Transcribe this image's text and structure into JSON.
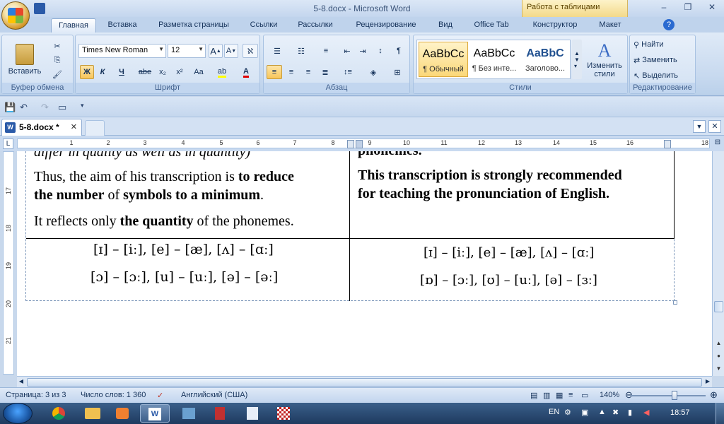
{
  "window": {
    "title": "5-8.docx - Microsoft Word",
    "context_tab": "Работа с таблицами"
  },
  "ribbon_tabs": [
    "Главная",
    "Вставка",
    "Разметка страницы",
    "Ссылки",
    "Рассылки",
    "Рецензирование",
    "Вид",
    "Office Tab",
    "Конструктор",
    "Макет"
  ],
  "clipboard": {
    "paste_label": "Вставить",
    "group_label": "Буфер обмена"
  },
  "font": {
    "name": "Times New Roman",
    "size": "12",
    "group_label": "Шрифт",
    "bold_label": "Ж",
    "italic_label": "К",
    "underline_label": "Ч",
    "strike_label": "abe",
    "sub_label": "x₂",
    "sup_label": "x²",
    "case_label": "Aa"
  },
  "paragraph": {
    "group_label": "Абзац"
  },
  "styles": {
    "group_label": "Стили",
    "items": [
      {
        "sample": "AaBbCc",
        "name": "¶ Обычный"
      },
      {
        "sample": "AaBbCc",
        "name": "¶ Без инте..."
      },
      {
        "sample": "AaBbC",
        "name": "Заголово..."
      }
    ],
    "change_label": "Изменить стили"
  },
  "editing": {
    "group_label": "Редактирование",
    "find": "Найти",
    "replace": "Заменить",
    "select": "Выделить"
  },
  "doc_tab": {
    "label": "5-8.docx *"
  },
  "ruler": {
    "numbers": [
      "1",
      "2",
      "3",
      "4",
      "5",
      "6",
      "7",
      "8",
      "9",
      "10",
      "11",
      "12",
      "13",
      "14",
      "15",
      "16",
      "18"
    ]
  },
  "vruler": {
    "numbers": [
      "17",
      "18",
      "19",
      "20",
      "21"
    ]
  },
  "document": {
    "left_top_cut": "differ in quality as well as in quantity)",
    "left_p1a_pre": "Thus, the aim of his transcription is ",
    "left_p1a_bold": "to reduce",
    "left_p1b_bold": "the number",
    "left_p1b_mid": " of ",
    "left_p1b_bold2": "symbols to a minimum",
    "left_p1b_end": ".",
    "left_p2_pre": "It reflects only ",
    "left_p2_bold": "the quantity",
    "left_p2_end": " of the phonemes.",
    "right_top_cut": "phonemes.",
    "right_p1": "This transcription  is strongly  recommended",
    "right_p2": "for teaching  the pronunciation  of English.",
    "left_sym1": "[ɪ] – [iː], [e] – [æ], [ʌ] – [ɑː]",
    "left_sym2": "[ɔ] – [ɔː], [u] – [uː], [ə] – [əː]",
    "right_sym1": "[ɪ] – [iː], [e] – [æ], [ʌ] – [ɑː]",
    "right_sym2": "[ɒ] – [ɔː], [ʊ] – [uː], [ə] – [ɜː]"
  },
  "status": {
    "page": "Страница: 3 из 3",
    "words": "Число слов: 1 360",
    "language": "Английский (США)",
    "zoom": "140%"
  },
  "taskbar": {
    "lang": "EN",
    "time": "18:57"
  }
}
